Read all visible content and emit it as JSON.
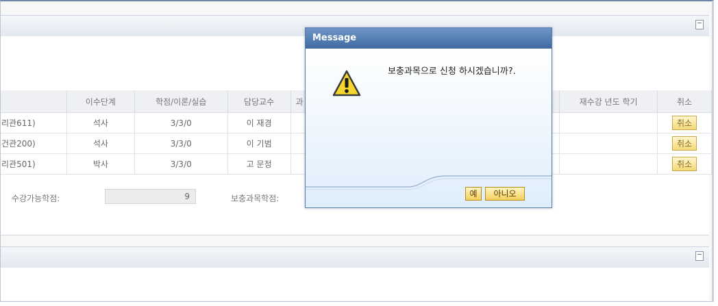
{
  "table": {
    "headers": [
      "이수단계",
      "학점/이론/실습",
      "담당교수",
      "과",
      "재수강 년도 학기",
      "취소"
    ],
    "rows": [
      {
        "room": "리관611)",
        "level": "석사",
        "credits": "3/3/0",
        "prof": "이 재경",
        "cancel": "취소"
      },
      {
        "room": "건관200)",
        "level": "석사",
        "credits": "3/3/0",
        "prof": "이 기범",
        "cancel": "취소"
      },
      {
        "room": "리관501)",
        "level": "박사",
        "credits": "3/3/0",
        "prof": "고 문정",
        "cancel": "취소"
      }
    ]
  },
  "summary": {
    "available_label": "수강가능학점:",
    "available_value": "9",
    "supplementary_label": "보충과목학점:"
  },
  "dialog": {
    "title": "Message",
    "message": "보충과목으로 신청 하시겠습니까?.",
    "yes_label": "예",
    "no_label": "아니오",
    "icon": "warning-icon"
  },
  "colors": {
    "dialog_title_bg": "#4a74a9",
    "button_bg": "#f4cf5c",
    "warning_yellow": "#f5d530"
  }
}
